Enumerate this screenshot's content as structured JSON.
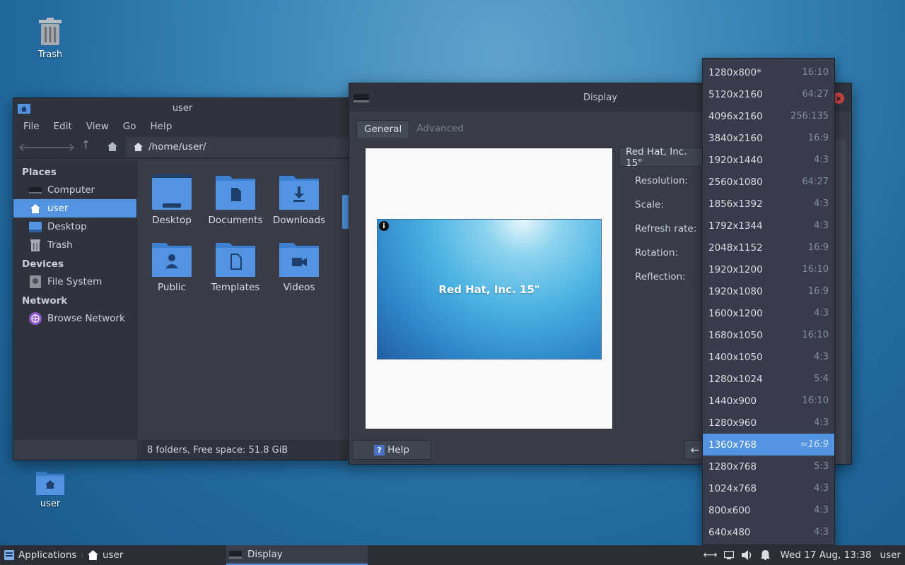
{
  "desktop": {
    "icons": [
      {
        "label": "Trash",
        "icon": "trash-icon"
      },
      {
        "label": "user",
        "icon": "home-folder-icon"
      }
    ]
  },
  "file_manager": {
    "title": "user",
    "menu": [
      "File",
      "Edit",
      "View",
      "Go",
      "Help"
    ],
    "path": "/home/user/",
    "sidebar": {
      "places_header": "Places",
      "places": [
        {
          "label": "Computer",
          "icon": "computer-icon"
        },
        {
          "label": "user",
          "icon": "home-icon"
        },
        {
          "label": "Desktop",
          "icon": "desktop-icon"
        },
        {
          "label": "Trash",
          "icon": "trash-icon"
        }
      ],
      "devices_header": "Devices",
      "devices": [
        {
          "label": "File System",
          "icon": "drive-icon"
        }
      ],
      "network_header": "Network",
      "network": [
        {
          "label": "Browse Network",
          "icon": "network-icon"
        }
      ]
    },
    "folders": [
      "Desktop",
      "Documents",
      "Downloads",
      "Public",
      "Templates",
      "Videos"
    ],
    "status": "8 folders, Free space: 51.8 GiB"
  },
  "display_dialog": {
    "title": "Display",
    "tabs": [
      "General",
      "Advanced"
    ],
    "monitor_name": "Red Hat, Inc. 15\"",
    "monitor_select": "Red Hat, Inc. 15\"",
    "info_glyph": "i",
    "labels": {
      "resolution": "Resolution:",
      "scale": "Scale:",
      "refresh_rate": "Refresh rate:",
      "rotation": "Rotation:",
      "reflection": "Reflection:"
    },
    "help_label": "Help",
    "help_glyph": "?"
  },
  "resolutions": [
    {
      "res": "1280x800*",
      "ratio": "16:10"
    },
    {
      "res": "5120x2160",
      "ratio": "64:27"
    },
    {
      "res": "4096x2160",
      "ratio": "256:135"
    },
    {
      "res": "3840x2160",
      "ratio": "16:9"
    },
    {
      "res": "1920x1440",
      "ratio": "4:3"
    },
    {
      "res": "2560x1080",
      "ratio": "64:27"
    },
    {
      "res": "1856x1392",
      "ratio": "4:3"
    },
    {
      "res": "1792x1344",
      "ratio": "4:3"
    },
    {
      "res": "2048x1152",
      "ratio": "16:9"
    },
    {
      "res": "1920x1200",
      "ratio": "16:10"
    },
    {
      "res": "1920x1080",
      "ratio": "16:9"
    },
    {
      "res": "1600x1200",
      "ratio": "4:3"
    },
    {
      "res": "1680x1050",
      "ratio": "16:10"
    },
    {
      "res": "1400x1050",
      "ratio": "4:3"
    },
    {
      "res": "1280x1024",
      "ratio": "5:4"
    },
    {
      "res": "1440x900",
      "ratio": "16:10"
    },
    {
      "res": "1280x960",
      "ratio": "4:3"
    },
    {
      "res": "1360x768",
      "ratio": "≈16:9",
      "selected": true
    },
    {
      "res": "1280x768",
      "ratio": "5:3"
    },
    {
      "res": "1024x768",
      "ratio": "4:3"
    },
    {
      "res": "800x600",
      "ratio": "4:3"
    },
    {
      "res": "640x480",
      "ratio": "4:3"
    }
  ],
  "taskbar": {
    "applications": "Applications",
    "places": "user",
    "task": "Display",
    "clock": "Wed 17 Aug, 13:38",
    "user": "user"
  },
  "colors": {
    "accent": "#5294e2",
    "folder": "#5294e2",
    "panel": "#2b2e37",
    "window": "#373c48"
  }
}
